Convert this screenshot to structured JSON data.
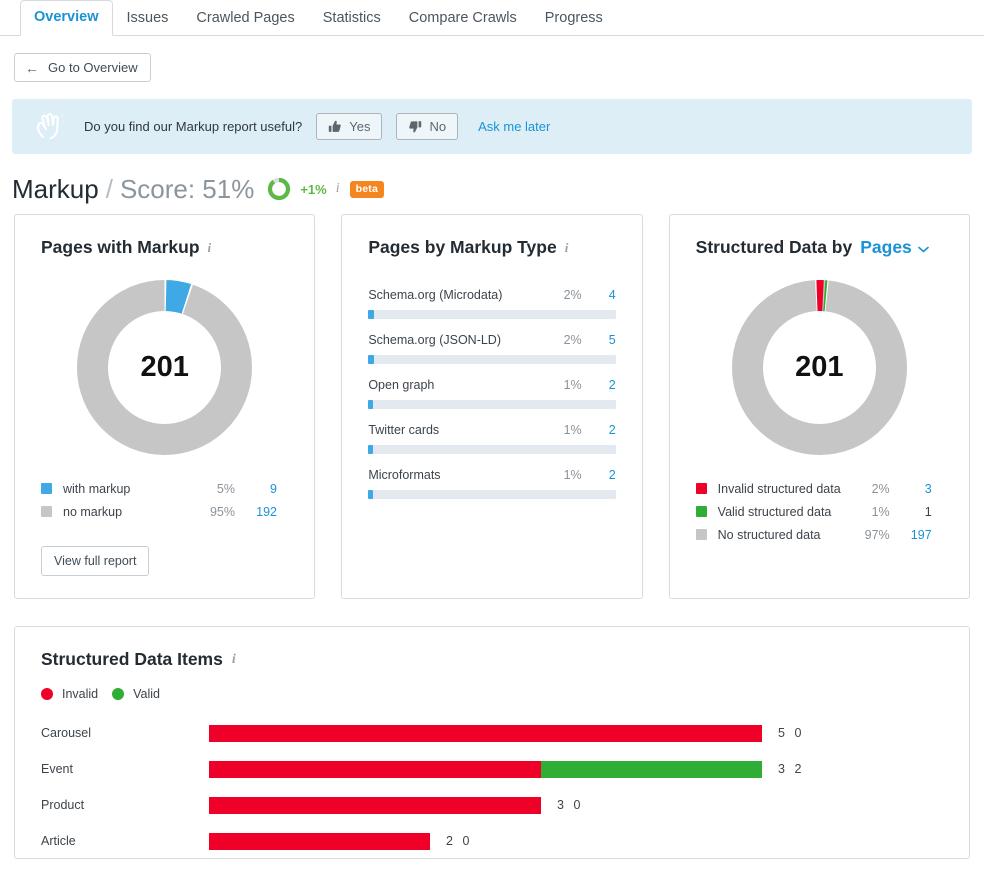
{
  "tabs": [
    {
      "label": "Overview",
      "active": true
    },
    {
      "label": "Issues",
      "active": false
    },
    {
      "label": "Crawled Pages",
      "active": false
    },
    {
      "label": "Statistics",
      "active": false
    },
    {
      "label": "Compare Crawls",
      "active": false
    },
    {
      "label": "Progress",
      "active": false
    }
  ],
  "back_button": {
    "label": "Go to Overview",
    "arrow": "←"
  },
  "banner": {
    "question": "Do you find our Markup report useful?",
    "yes_label": "Yes",
    "no_label": "No",
    "ask_later_label": "Ask me later",
    "bg": "#ddeef7"
  },
  "title": {
    "main": "Markup",
    "separator": "/",
    "score_label": "Score: 51%",
    "score_value": 51,
    "delta": "+1%",
    "info": "i",
    "beta": "beta",
    "ring_color": "#5eb847"
  },
  "cards": {
    "pages_with_markup": {
      "heading": "Pages with Markup",
      "info": "i",
      "total": "201",
      "legend": [
        {
          "label": "with markup",
          "pct": "5%",
          "value": "9",
          "color": "#3fa9e5",
          "link": true
        },
        {
          "label": "no markup",
          "pct": "95%",
          "value": "192",
          "color": "#c6c6c6",
          "link": true
        }
      ],
      "button": "View full report"
    },
    "pages_by_markup_type": {
      "heading": "Pages by Markup Type",
      "info": "i",
      "items": [
        {
          "name": "Schema.org (Microdata)",
          "pct": "2%",
          "value": "4",
          "fill_pct": 2
        },
        {
          "name": "Schema.org (JSON-LD)",
          "pct": "2%",
          "value": "5",
          "fill_pct": 2
        },
        {
          "name": "Open graph",
          "pct": "1%",
          "value": "2",
          "fill_pct": 1.5
        },
        {
          "name": "Twitter cards",
          "pct": "1%",
          "value": "2",
          "fill_pct": 1.5
        },
        {
          "name": "Microformats",
          "pct": "1%",
          "value": "2",
          "fill_pct": 1.5
        }
      ]
    },
    "structured_data_by": {
      "heading": "Structured Data by",
      "selector_label": "Pages",
      "total": "201",
      "legend": [
        {
          "label": "Invalid structured data",
          "pct": "2%",
          "value": "3",
          "color": "#ef0028",
          "link": true
        },
        {
          "label": "Valid structured data",
          "pct": "1%",
          "value": "1",
          "color": "#30ad34",
          "link": false
        },
        {
          "label": "No structured data",
          "pct": "97%",
          "value": "197",
          "color": "#c6c6c6",
          "link": true
        }
      ]
    }
  },
  "structured_data_items": {
    "heading": "Structured Data Items",
    "info": "i",
    "legend": [
      {
        "label": "Invalid",
        "color": "#ef0028"
      },
      {
        "label": "Valid",
        "color": "#30ad34"
      }
    ]
  },
  "chart_data": {
    "type": "bar",
    "title": "Structured Data Items",
    "orientation": "horizontal",
    "stacked": true,
    "categories": [
      "Carousel",
      "Event",
      "Product",
      "Article"
    ],
    "series": [
      {
        "name": "Invalid",
        "color": "#ef0028",
        "values": [
          5,
          3,
          3,
          2
        ]
      },
      {
        "name": "Valid",
        "color": "#30ad34",
        "values": [
          0,
          2,
          0,
          0
        ]
      }
    ],
    "xlabel": "",
    "ylabel": "",
    "xlim": [
      0,
      5
    ],
    "grid": false,
    "legend_position": "top-left"
  },
  "donut_charts": [
    {
      "name": "Pages with Markup",
      "type": "pie",
      "center_value": 201,
      "slices": [
        {
          "label": "with markup",
          "value": 9,
          "pct": 5,
          "color": "#3fa9e5"
        },
        {
          "label": "no markup",
          "value": 192,
          "pct": 95,
          "color": "#c6c6c6"
        }
      ]
    },
    {
      "name": "Structured Data by Pages",
      "type": "pie",
      "center_value": 201,
      "slices": [
        {
          "label": "Invalid structured data",
          "value": 3,
          "pct": 2,
          "color": "#ef0028"
        },
        {
          "label": "Valid structured data",
          "value": 1,
          "pct": 1,
          "color": "#30ad34"
        },
        {
          "label": "No structured data",
          "value": 197,
          "pct": 97,
          "color": "#c6c6c6"
        }
      ]
    }
  ]
}
